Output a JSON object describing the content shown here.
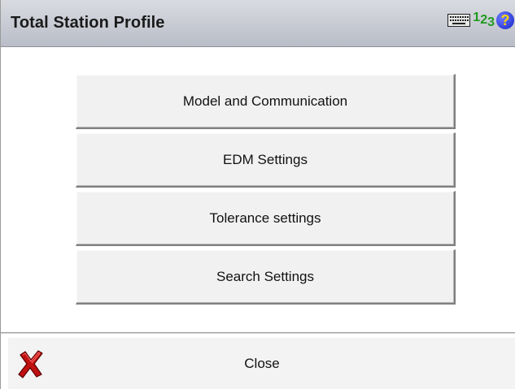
{
  "window": {
    "title": "Total Station Profile"
  },
  "toolbar": {
    "numeric_digits": [
      "1",
      "2",
      "3"
    ],
    "help_glyph": "?"
  },
  "menu": {
    "buttons": [
      {
        "label": "Model and Communication"
      },
      {
        "label": "EDM Settings"
      },
      {
        "label": "Tolerance settings"
      },
      {
        "label": "Search Settings"
      }
    ]
  },
  "footer": {
    "close_label": "Close"
  },
  "icons": {
    "keyboard": "keyboard-icon",
    "numeric": "numeric-input-icon",
    "help": "help-icon",
    "close": "close-icon"
  },
  "colors": {
    "titlebar_top": "#d9dbe1",
    "titlebar_bottom": "#b9bdc7",
    "numeric_green": "#1f9a1f",
    "help_blue": "#1322c8",
    "help_yellow": "#ffd400",
    "close_red": "#c01010"
  }
}
